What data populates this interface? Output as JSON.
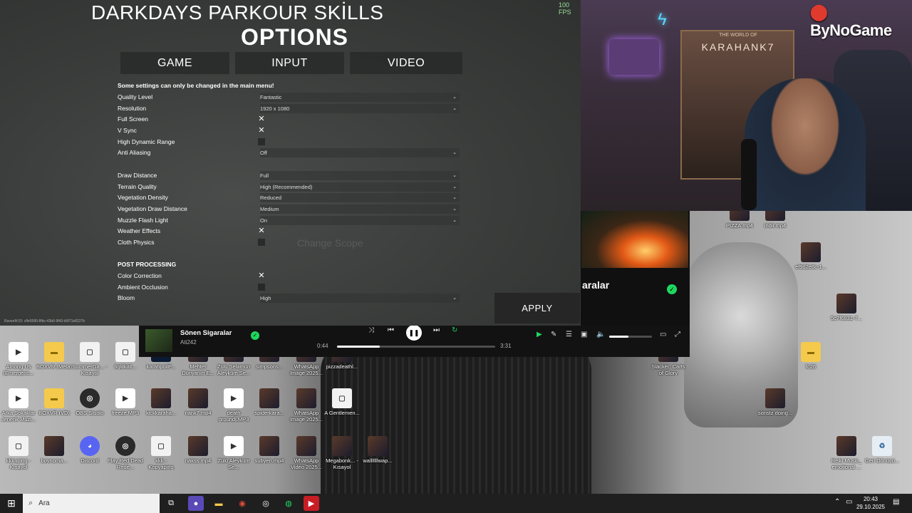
{
  "game": {
    "title": "DARKDAYS PARKOUR SKİLLS",
    "options_title": "OPTIONS",
    "fps": "100 FPS",
    "tabs": [
      "GAME",
      "INPUT",
      "VIDEO"
    ],
    "note": "Some settings can only be changed in the main menu!",
    "settings": [
      {
        "label": "Quality Level",
        "value": "Fantastic",
        "kind": "dropdown"
      },
      {
        "label": "Resolution",
        "value": "1920 x 1080",
        "kind": "dropdown"
      },
      {
        "label": "Full Screen",
        "value": "✕",
        "kind": "check"
      },
      {
        "label": "V Sync",
        "value": "✕",
        "kind": "check"
      },
      {
        "label": "High Dynamic Range",
        "value": "",
        "kind": "empty"
      },
      {
        "label": "Anti Aliasing",
        "value": "Off",
        "kind": "dropdown"
      },
      {
        "label": "Draw Distance",
        "value": "Full",
        "kind": "dropdown"
      },
      {
        "label": "Terrain Quality",
        "value": "High (Recommended)",
        "kind": "dropdown"
      },
      {
        "label": "Vegetation Density",
        "value": "Reduced",
        "kind": "dropdown"
      },
      {
        "label": "Vegetation Draw Distance",
        "value": "Medium",
        "kind": "dropdown"
      },
      {
        "label": "Muzzle Flash Light",
        "value": "On",
        "kind": "dropdown"
      },
      {
        "label": "Weather Effects",
        "value": "✕",
        "kind": "check"
      },
      {
        "label": "Cloth Physics",
        "value": "",
        "kind": "empty"
      }
    ],
    "post_header": "POST PROCESSING",
    "post_settings": [
      {
        "label": "Color Correction",
        "value": "✕",
        "kind": "check"
      },
      {
        "label": "Ambient Occlusion",
        "value": "",
        "kind": "empty"
      },
      {
        "label": "Bloom",
        "value": "High",
        "kind": "dropdown"
      }
    ],
    "apply": "APPLY",
    "ravenm": "RavenM ID: cffe5580-8fbc-43b6-9f43-b0f71e8227b",
    "scope_ghost": "Change Scope"
  },
  "webcam": {
    "brand": "ByNoGame",
    "poster_small": "THE WORLD OF",
    "poster_big": "KARAHANK7"
  },
  "spotify": {
    "big_title": "aralar",
    "title": "Sönen Sigaralar",
    "artist": "Ati242",
    "elapsed": "0:44",
    "total": "3:31",
    "progress": 0.27,
    "volume": 0.45
  },
  "desktop_icons": [
    {
      "cap": "Among Us (Emergenc...",
      "kind": "vid"
    },
    {
      "cap": "BOXVR (Meta)",
      "kind": "folder"
    },
    {
      "cap": "SummerGa... - Kısayol",
      "kind": "file"
    },
    {
      "cap": "figlitkitit...",
      "kind": "file"
    },
    {
      "cap": "karahpoilP...",
      "kind": "ps"
    },
    {
      "cap": "Mehter Dünyanın E...",
      "kind": "img"
    },
    {
      "cap": "Zülü Selamün Aleyküm Se...",
      "kind": "img"
    },
    {
      "cap": "simpsons...",
      "kind": "img"
    },
    {
      "cap": "WhatsApp Image 2025...",
      "kind": "img"
    },
    {
      "cap": "pizzadeathl...",
      "kind": "img"
    },
    {
      "cap": "Arka Sokaklar Jenerik Müzi...",
      "kind": "vid"
    },
    {
      "cap": "BOXVR (VD)",
      "kind": "folder"
    },
    {
      "cap": "OBS Studio",
      "kind": "app"
    },
    {
      "cap": "freeze.MP3",
      "kind": "vid"
    },
    {
      "cap": "kickkaraha...",
      "kind": "img"
    },
    {
      "cap": "nank7.mp4",
      "kind": "img"
    },
    {
      "cap": "death groundj.MP3",
      "kind": "vid"
    },
    {
      "cap": "spiderkara...",
      "kind": "img"
    },
    {
      "cap": "WhatsApp Image 2025...",
      "kind": "img"
    },
    {
      "cap": "A Gentlemen...",
      "kind": "file"
    },
    {
      "cap": "kkkaping - Kısayol",
      "kind": "file"
    },
    {
      "cap": "boynoma...",
      "kind": "img"
    },
    {
      "cap": "Discord",
      "kind": "disc"
    },
    {
      "cap": "Play Red Dead Rede...",
      "kind": "app"
    },
    {
      "cap": "kkk - Kopyaping",
      "kind": "file"
    },
    {
      "cap": "nakss.mp4",
      "kind": "img"
    },
    {
      "cap": "Zülü Aleyküm Se...",
      "kind": "vid"
    },
    {
      "cap": "subyen.mp4",
      "kind": "img"
    },
    {
      "cap": "WhatsApp Video 2025...",
      "kind": "img"
    },
    {
      "cap": "Megabonk... - Kısayol",
      "kind": "img"
    },
    {
      "cap": "walllllllwap...",
      "kind": "img"
    },
    {
      "cap": "PIZZA.mp4",
      "kind": "img"
    },
    {
      "cap": "indir.mp4",
      "kind": "img"
    },
    {
      "cap": "ef9d2e8c-1...",
      "kind": "img"
    },
    {
      "cap": "5c7f6831-7...",
      "kind": "img"
    },
    {
      "cap": "Slacker: Carts of Glory",
      "kind": "img"
    },
    {
      "cap": "fc26",
      "kind": "folder"
    },
    {
      "cap": "sonstz doing...",
      "kind": "img"
    },
    {
      "cap": "Reiki Music_ emotional ...",
      "kind": "img"
    },
    {
      "cap": "Geri Dönüşü...",
      "kind": "bin"
    }
  ],
  "taskbar": {
    "search_placeholder": "Ara",
    "time": "20:43",
    "date": "29.10.2025"
  }
}
